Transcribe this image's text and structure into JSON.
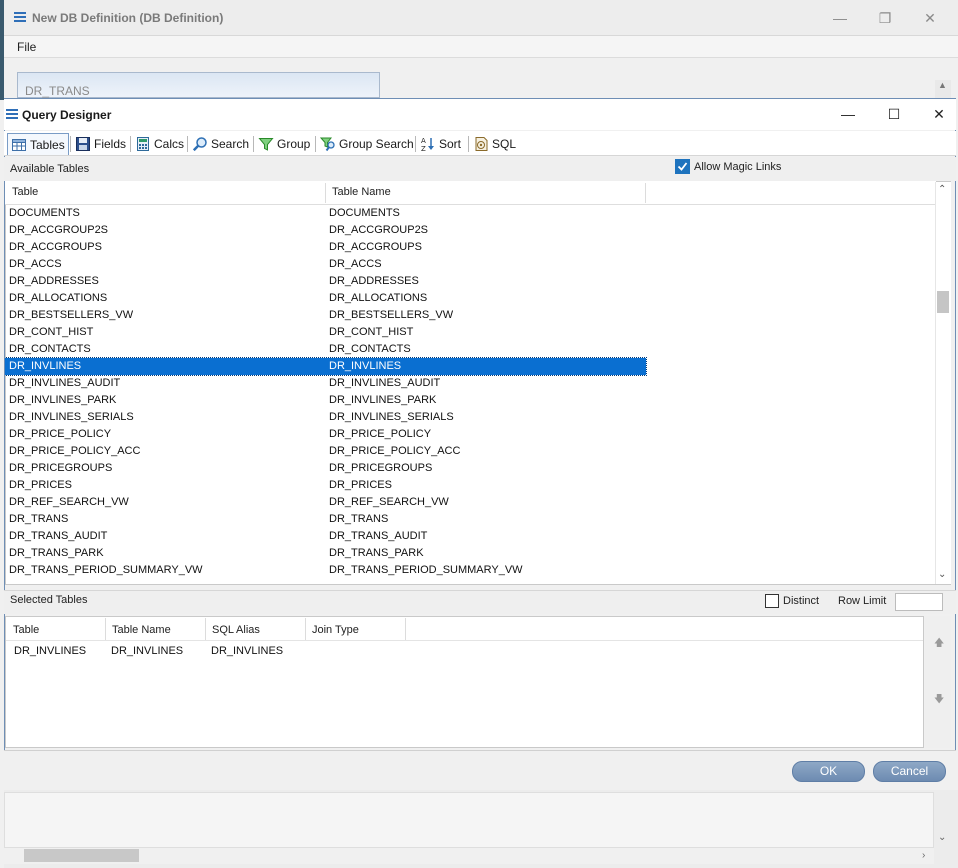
{
  "parent_window": {
    "title": "New DB Definition (DB Definition)",
    "menu_file": "File",
    "field_value": "DR_TRANS",
    "controls": {
      "minimize": "—",
      "restore": "❐",
      "close": "✕"
    }
  },
  "dialog": {
    "title": "Query Designer",
    "controls": {
      "minimize": "—",
      "maximize": "☐",
      "close": "✕"
    }
  },
  "toolbar": {
    "tabs": [
      {
        "label": "Tables",
        "icon": "table-icon"
      },
      {
        "label": "Fields",
        "icon": "save-fields-icon"
      },
      {
        "label": "Calcs",
        "icon": "calculator-icon"
      },
      {
        "label": "Search",
        "icon": "magnifier-icon"
      },
      {
        "label": "Group",
        "icon": "funnel-icon"
      },
      {
        "label": "Group Search",
        "icon": "group-search-icon"
      },
      {
        "label": "Sort",
        "icon": "sort-az-icon"
      },
      {
        "label": "SQL",
        "icon": "sql-icon"
      }
    ],
    "active_tab": "Tables"
  },
  "available": {
    "label": "Available Tables",
    "magic_links_label": "Allow Magic Links",
    "magic_links_checked": true,
    "columns": [
      "Table",
      "Table Name"
    ],
    "selected_row": "DR_INVLINES",
    "rows": [
      [
        "DOCUMENTS",
        "DOCUMENTS"
      ],
      [
        "DR_ACCGROUP2S",
        "DR_ACCGROUP2S"
      ],
      [
        "DR_ACCGROUPS",
        "DR_ACCGROUPS"
      ],
      [
        "DR_ACCS",
        "DR_ACCS"
      ],
      [
        "DR_ADDRESSES",
        "DR_ADDRESSES"
      ],
      [
        "DR_ALLOCATIONS",
        "DR_ALLOCATIONS"
      ],
      [
        "DR_BESTSELLERS_VW",
        "DR_BESTSELLERS_VW"
      ],
      [
        "DR_CONT_HIST",
        "DR_CONT_HIST"
      ],
      [
        "DR_CONTACTS",
        "DR_CONTACTS"
      ],
      [
        "DR_INVLINES",
        "DR_INVLINES"
      ],
      [
        "DR_INVLINES_AUDIT",
        "DR_INVLINES_AUDIT"
      ],
      [
        "DR_INVLINES_PARK",
        "DR_INVLINES_PARK"
      ],
      [
        "DR_INVLINES_SERIALS",
        "DR_INVLINES_SERIALS"
      ],
      [
        "DR_PRICE_POLICY",
        "DR_PRICE_POLICY"
      ],
      [
        "DR_PRICE_POLICY_ACC",
        "DR_PRICE_POLICY_ACC"
      ],
      [
        "DR_PRICEGROUPS",
        "DR_PRICEGROUPS"
      ],
      [
        "DR_PRICES",
        "DR_PRICES"
      ],
      [
        "DR_REF_SEARCH_VW",
        "DR_REF_SEARCH_VW"
      ],
      [
        "DR_TRANS",
        "DR_TRANS"
      ],
      [
        "DR_TRANS_AUDIT",
        "DR_TRANS_AUDIT"
      ],
      [
        "DR_TRANS_PARK",
        "DR_TRANS_PARK"
      ],
      [
        "DR_TRANS_PERIOD_SUMMARY_VW",
        "DR_TRANS_PERIOD_SUMMARY_VW"
      ]
    ]
  },
  "selected": {
    "label": "Selected Tables",
    "distinct_label": "Distinct",
    "distinct_checked": false,
    "row_limit_label": "Row Limit",
    "row_limit_value": "",
    "columns": [
      "Table",
      "Table Name",
      "SQL Alias",
      "Join Type"
    ],
    "rows": [
      [
        "DR_INVLINES",
        "DR_INVLINES",
        "DR_INVLINES",
        ""
      ]
    ]
  },
  "buttons": {
    "ok": "OK",
    "cancel": "Cancel"
  },
  "colors": {
    "selection": "#0a6fd1",
    "button": "#7a96ba",
    "accent": "#1e73be"
  }
}
